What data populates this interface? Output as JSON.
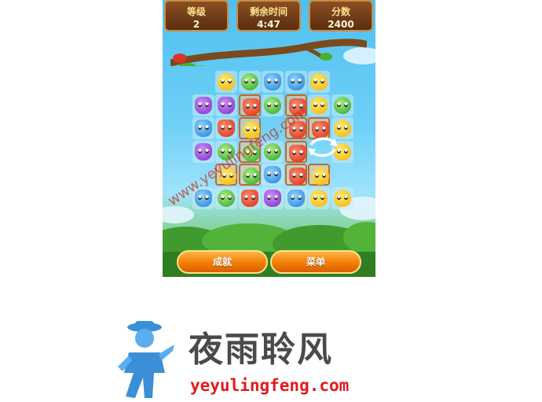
{
  "hud": {
    "level": {
      "label": "等级",
      "value": "2"
    },
    "time": {
      "label": "剩余时间",
      "value": "4:47"
    },
    "score": {
      "label": "分数",
      "value": "2400"
    }
  },
  "board": {
    "rows": [
      [
        "",
        "",
        "chick",
        "frog",
        "blue",
        "blue",
        "chick",
        "",
        ""
      ],
      [
        "",
        "purple",
        "purple",
        "red",
        "frog",
        "red",
        "chick",
        "frog",
        ""
      ],
      [
        "",
        "blue",
        "red",
        "chick",
        "",
        "red",
        "red",
        "chick",
        ""
      ],
      [
        "",
        "purple",
        "frog",
        "frog",
        "frog",
        "red",
        "",
        "chick",
        ""
      ],
      [
        "",
        "",
        "chick",
        "frog",
        "blue",
        "red",
        "chick",
        "",
        ""
      ],
      [
        "",
        "blue",
        "frog",
        "red",
        "purple",
        "blue",
        "chick",
        "chick",
        ""
      ]
    ],
    "boxed": [
      [
        1,
        3
      ],
      [
        1,
        5
      ],
      [
        2,
        3
      ],
      [
        2,
        5
      ],
      [
        2,
        6
      ],
      [
        3,
        3
      ],
      [
        3,
        5
      ],
      [
        4,
        2
      ],
      [
        4,
        3
      ],
      [
        4,
        5
      ],
      [
        4,
        6
      ]
    ]
  },
  "buttons": {
    "achievements": "成就",
    "menu": "菜单"
  },
  "watermark": "www.yeyulingfeng.com",
  "logo": {
    "name": "夜雨聆风",
    "url": "yeyulingfeng.com"
  },
  "colors": {
    "hud_bg": "#6b3a17",
    "button": "#f07a00",
    "logo_url": "#e01b1b"
  }
}
